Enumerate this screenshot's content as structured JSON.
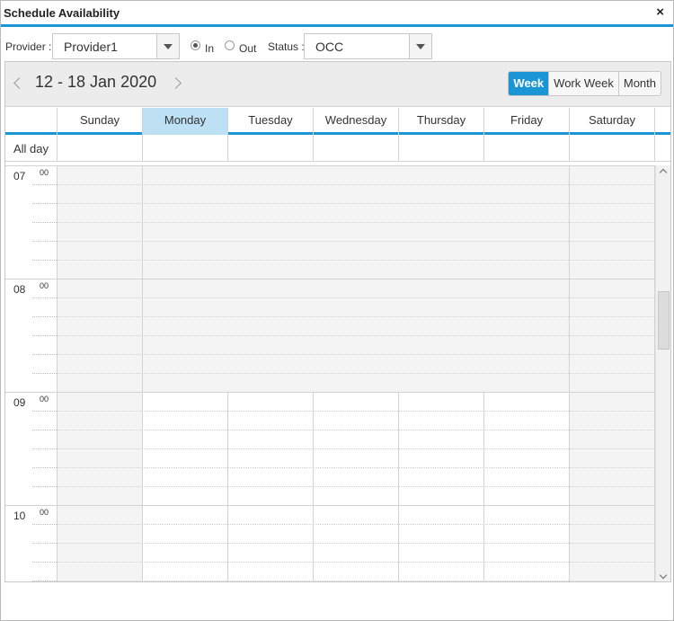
{
  "dialog": {
    "title": "Schedule Availability",
    "close_glyph": "×"
  },
  "toolbar": {
    "provider_label": "Provider :",
    "provider_value": "Provider1",
    "radio_in_label": "In",
    "radio_out_label": "Out",
    "radio_selected": "In",
    "status_label": "Status :",
    "status_value": "OCC"
  },
  "scheduler": {
    "date_range": "12 - 18 Jan 2020",
    "views": [
      {
        "label": "Week",
        "active": true
      },
      {
        "label": "Work Week",
        "active": false
      },
      {
        "label": "Month",
        "active": false
      }
    ],
    "days": [
      "Sunday",
      "Monday",
      "Tuesday",
      "Wednesday",
      "Thursday",
      "Friday",
      "Saturday"
    ],
    "selected_day": "Monday",
    "allday_label": "All day",
    "hours": [
      {
        "hour": "07",
        "minute": "00"
      },
      {
        "hour": "08",
        "minute": "00"
      },
      {
        "hour": "09",
        "minute": "00"
      },
      {
        "hour": "10",
        "minute": "00"
      }
    ]
  },
  "colors": {
    "accent": "#1b95d3",
    "selected_day_bg": "#bde0f4",
    "nonwork_bg": "#f4f4f4"
  },
  "icons": {
    "close": "close-icon",
    "dropdown": "chevron-down-icon",
    "prev": "chevron-left-icon",
    "next": "chevron-right-icon"
  }
}
